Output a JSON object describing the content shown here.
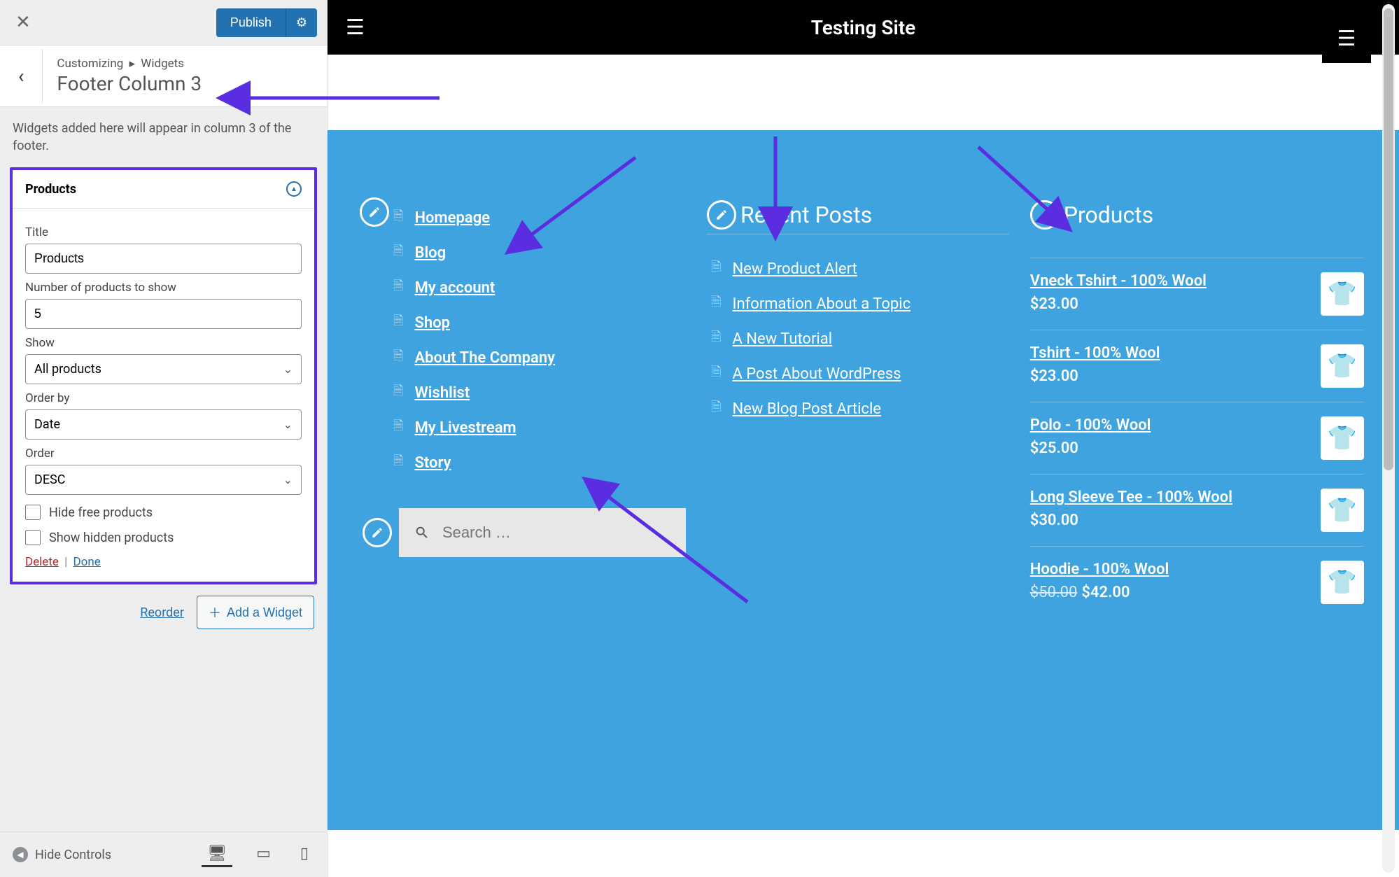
{
  "sidebar": {
    "publish_label": "Publish",
    "breadcrumb_root": "Customizing",
    "breadcrumb_leaf": "Widgets",
    "section_title": "Footer Column 3",
    "info": "Widgets added here will appear in column 3 of the footer.",
    "widget": {
      "name": "Products",
      "title_label": "Title",
      "title_value": "Products",
      "count_label": "Number of products to show",
      "count_value": "5",
      "show_label": "Show",
      "show_value": "All products",
      "orderby_label": "Order by",
      "orderby_value": "Date",
      "order_label": "Order",
      "order_value": "DESC",
      "hide_free_label": "Hide free products",
      "show_hidden_label": "Show hidden products",
      "delete_label": "Delete",
      "done_label": "Done"
    },
    "reorder_label": "Reorder",
    "add_widget_label": "Add a Widget",
    "hide_controls_label": "Hide Controls"
  },
  "preview": {
    "site_title": "Testing Site",
    "col1_links": [
      "Homepage",
      "Blog",
      "My account",
      "Shop",
      "About The Company",
      "Wishlist",
      "My Livestream",
      "Story"
    ],
    "col2_heading": "Recent Posts",
    "col2_links": [
      "New Product Alert",
      "Information About a Topic",
      "A New Tutorial",
      "A Post About WordPress",
      "New Blog Post Article"
    ],
    "col3_heading": "Products",
    "products": [
      {
        "name": "Vneck Tshirt - 100% Wool",
        "price": "$23.00",
        "color": "#f4a08a"
      },
      {
        "name": "Tshirt - 100% Wool",
        "price": "$23.00",
        "color": "#dcdcdc"
      },
      {
        "name": "Polo - 100% Wool",
        "price": "$25.00",
        "color": "#b8e0d8"
      },
      {
        "name": "Long Sleeve Tee - 100% Wool",
        "price": "$30.00",
        "color": "#a8d8c8"
      },
      {
        "name": "Hoodie - 100% Wool",
        "price": "$42.00",
        "old": "$50.00",
        "color": "#f4a08a"
      }
    ],
    "search_placeholder": "Search …"
  }
}
